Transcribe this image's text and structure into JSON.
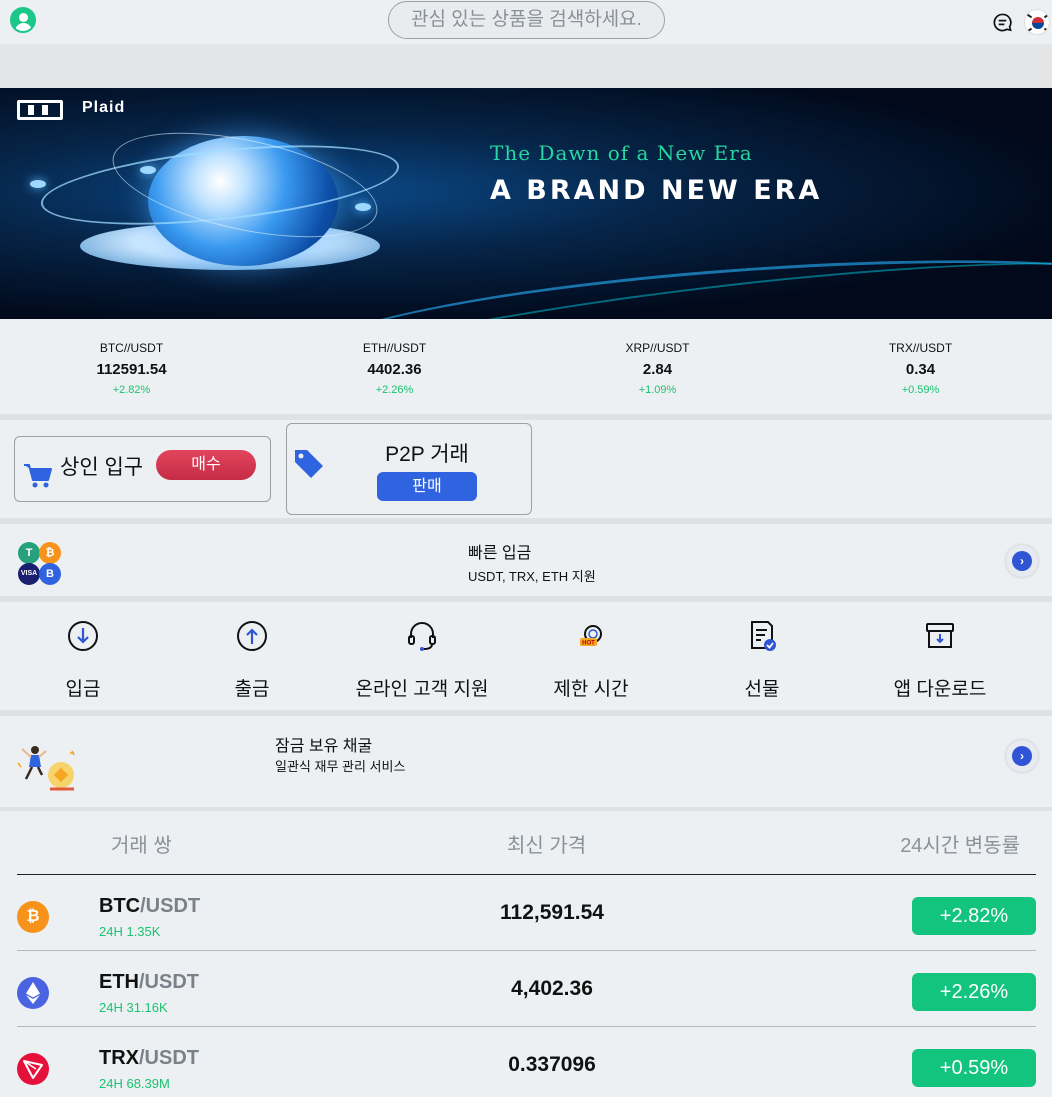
{
  "header": {
    "search_placeholder": "관심 있는 상품을 검색하세요."
  },
  "banner": {
    "brand": "Plaid",
    "subtitle": "The Dawn of a New Era",
    "title": "A BRAND NEW ERA"
  },
  "tickers": [
    {
      "pair": "BTC//USDT",
      "price": "112591.54",
      "change": "+2.82%"
    },
    {
      "pair": "ETH//USDT",
      "price": "4402.36",
      "change": "+2.26%"
    },
    {
      "pair": "XRP//USDT",
      "price": "2.84",
      "change": "+1.09%"
    },
    {
      "pair": "TRX//USDT",
      "price": "0.34",
      "change": "+0.59%"
    }
  ],
  "merchant": {
    "title": "상인 입구",
    "button": "매수"
  },
  "p2p": {
    "title": "P2P 거래",
    "button": "판매"
  },
  "quick_deposit": {
    "title": "빠른 입금",
    "subtitle": "USDT, TRX, ETH 지원",
    "coin_labels": [
      "T",
      "₿",
      "VISA",
      "B"
    ]
  },
  "grid": [
    {
      "label": "입금",
      "icon": "deposit-icon"
    },
    {
      "label": "출금",
      "icon": "withdraw-icon"
    },
    {
      "label": "온라인 고객 지원",
      "icon": "headset-icon"
    },
    {
      "label": "제한 시간",
      "icon": "hot-timer-icon"
    },
    {
      "label": "선물",
      "icon": "futures-icon"
    },
    {
      "label": "앱 다운로드",
      "icon": "app-download-icon"
    }
  ],
  "hot_badge": "HOT",
  "mining": {
    "title": "잠금 보유 채굴",
    "subtitle": "일관식 재무 관리 서비스"
  },
  "table": {
    "headers": {
      "pair": "거래 쌍",
      "price": "최신 가격",
      "change": "24시간 변동률"
    },
    "rows": [
      {
        "base": "BTC",
        "quote": "/USDT",
        "volume": "24H 1.35K",
        "price": "112,591.54",
        "change": "+2.82%",
        "coin_glyph": "₿"
      },
      {
        "base": "ETH",
        "quote": "/USDT",
        "volume": "24H 31.16K",
        "price": "4,402.36",
        "change": "+2.26%"
      },
      {
        "base": "TRX",
        "quote": "/USDT",
        "volume": "24H 68.39M",
        "price": "0.337096",
        "change": "+0.59%"
      }
    ]
  },
  "colors": {
    "up": "#1bc270",
    "change_badge": "#13c47e",
    "buy_button": "#d0354e",
    "sell_button": "#2f63e0",
    "accent_blue": "#2f55d4"
  }
}
